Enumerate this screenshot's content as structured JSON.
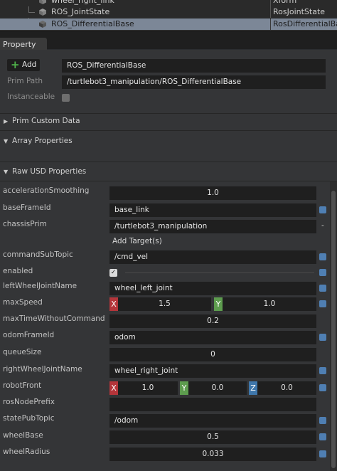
{
  "stage": {
    "rows": [
      {
        "name": "wheel_right_link",
        "type": "Xform",
        "selected": false
      },
      {
        "name": "ROS_JointState",
        "type": "RosJointState",
        "selected": false
      },
      {
        "name": "ROS_DifferentialBase",
        "type": "RosDifferentialBase",
        "selected": true
      }
    ]
  },
  "tab": {
    "label": "Property"
  },
  "header": {
    "add_label": "Add",
    "name_value": "ROS_DifferentialBase",
    "prim_path_label": "Prim Path",
    "prim_path_value": "/turtlebot3_manipulation/ROS_DifferentialBase",
    "instanceable_label": "Instanceable"
  },
  "sections": {
    "custom_data": "Prim Custom Data",
    "array": "Array Properties",
    "raw_usd": "Raw USD Properties"
  },
  "props": {
    "accelerationSmoothing": {
      "label": "accelerationSmoothing",
      "value": "1.0"
    },
    "baseFrameId": {
      "label": "baseFrameId",
      "value": "base_link"
    },
    "chassisPrim": {
      "label": "chassisPrim",
      "value": "/turtlebot3_manipulation",
      "remove": "-",
      "add_target": "Add Target(s)"
    },
    "commandSubTopic": {
      "label": "commandSubTopic",
      "value": "/cmd_vel"
    },
    "enabled": {
      "label": "enabled",
      "checked": "✓"
    },
    "leftWheelJointName": {
      "label": "leftWheelJointName",
      "value": "wheel_left_joint"
    },
    "maxSpeed": {
      "label": "maxSpeed",
      "x_label": "X",
      "x": "1.5",
      "y_label": "Y",
      "y": "1.0"
    },
    "maxTimeWithoutCommand": {
      "label": "maxTimeWithoutCommand",
      "value": "0.2"
    },
    "odomFrameId": {
      "label": "odomFrameId",
      "value": "odom"
    },
    "queueSize": {
      "label": "queueSize",
      "value": "0"
    },
    "rightWheelJointName": {
      "label": "rightWheelJointName",
      "value": "wheel_right_joint"
    },
    "robotFront": {
      "label": "robotFront",
      "x_label": "X",
      "x": "1.0",
      "y_label": "Y",
      "y": "0.0",
      "z_label": "Z",
      "z": "0.0"
    },
    "rosNodePrefix": {
      "label": "rosNodePrefix",
      "value": ""
    },
    "statePubTopic": {
      "label": "statePubTopic",
      "value": "/odom"
    },
    "wheelBase": {
      "label": "wheelBase",
      "value": "0.5"
    },
    "wheelRadius": {
      "label": "wheelRadius",
      "value": "0.033"
    }
  }
}
